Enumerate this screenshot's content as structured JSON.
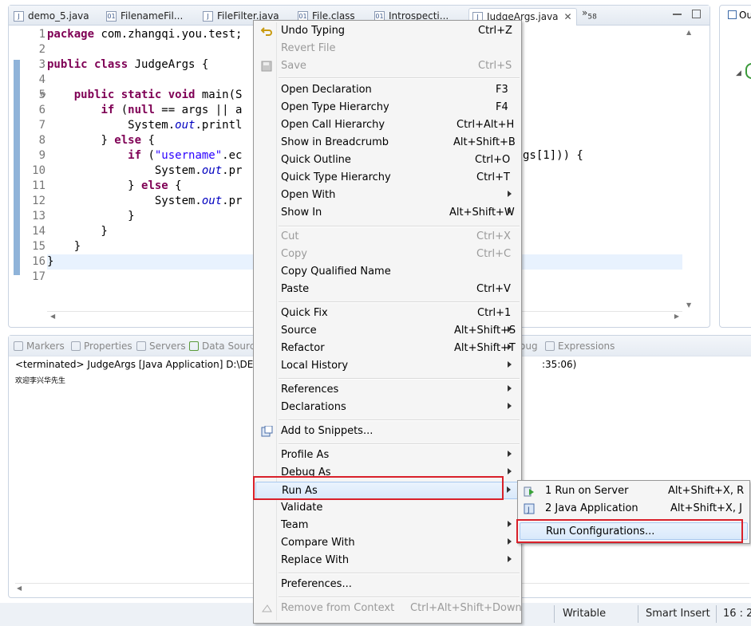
{
  "editor": {
    "tabs": [
      {
        "label": "demo_5.java",
        "icon": "java-file-icon"
      },
      {
        "label": "FilenameFil...",
        "icon": "class-file-icon"
      },
      {
        "label": "FileFilter.java",
        "icon": "java-file-icon"
      },
      {
        "label": "File.class",
        "icon": "class-file-icon"
      },
      {
        "label": "Introspecti...",
        "icon": "class-file-icon"
      },
      {
        "label": "JudgeArgs.java",
        "icon": "java-file-icon",
        "active": true
      }
    ],
    "overflow_label": "»",
    "overflow_count": "58",
    "close_glyph": "✕",
    "line_numbers": [
      "1",
      "2",
      "3",
      "4",
      "5",
      "6",
      "7",
      "8",
      "9",
      "10",
      "11",
      "12",
      "13",
      "14",
      "15",
      "16",
      "17"
    ],
    "code": {
      "l1_kw": "package",
      "l1_rest": " com.zhangqi.you.test;",
      "l3_kw": "public class",
      "l3_rest": " JudgeArgs {",
      "l5_indent": "    ",
      "l5_kw": "public static void",
      "l5_rest": " main(S",
      "l6_indent": "        ",
      "l6_kw1": "if",
      "l6_mid1": " (",
      "l6_kw2": "null",
      "l6_rest": " == args || a",
      "l7_indent": "            ",
      "l7_a": "System.",
      "l7_b": "out",
      "l7_c": ".printl",
      "l8_indent": "        ",
      "l8_a": "} ",
      "l8_kw": "else",
      "l8_b": " {",
      "l9_indent": "            ",
      "l9_kw": "if",
      "l9_a": " (",
      "l9_str": "\"username\"",
      "l9_b": ".ec",
      "l9_tail": "gs[1])) {",
      "l10_indent": "                ",
      "l10_a": "System.",
      "l10_b": "out",
      "l10_c": ".pr",
      "l11_indent": "            ",
      "l11_a": "} ",
      "l11_kw": "else",
      "l11_b": " {",
      "l12_indent": "                ",
      "l12_a": "System.",
      "l12_b": "out",
      "l12_c": ".pr",
      "l13": "            }",
      "l14": "        }",
      "l15": "    }",
      "l16": "}"
    }
  },
  "outline": {
    "title": "Ou"
  },
  "console": {
    "tabs": [
      {
        "label": "Markers"
      },
      {
        "label": "Properties"
      },
      {
        "label": "Servers"
      },
      {
        "label": "Data Source"
      },
      {
        "label": "oug"
      },
      {
        "label": "Expressions"
      }
    ],
    "header": "<terminated> JudgeArgs [Java Application] D:\\DEV_",
    "header_tail": ":35:06)",
    "output": "欢迎李兴华先生"
  },
  "statusbar": {
    "writable": "Writable",
    "insert_mode": "Smart Insert",
    "position": "16 : 2"
  },
  "context_menu": {
    "undo_typing": {
      "label": "Undo Typing",
      "accel": "Ctrl+Z"
    },
    "revert_file": {
      "label": "Revert File"
    },
    "save": {
      "label": "Save",
      "accel": "Ctrl+S"
    },
    "open_declaration": {
      "label": "Open Declaration",
      "accel": "F3"
    },
    "open_type_hierarchy": {
      "label": "Open Type Hierarchy",
      "accel": "F4"
    },
    "open_call_hierarchy": {
      "label": "Open Call Hierarchy",
      "accel": "Ctrl+Alt+H"
    },
    "show_in_breadcrumb": {
      "label": "Show in Breadcrumb",
      "accel": "Alt+Shift+B"
    },
    "quick_outline": {
      "label": "Quick Outline",
      "accel": "Ctrl+O"
    },
    "quick_type_hierarchy": {
      "label": "Quick Type Hierarchy",
      "accel": "Ctrl+T"
    },
    "open_with": {
      "label": "Open With"
    },
    "show_in": {
      "label": "Show In",
      "accel": "Alt+Shift+W"
    },
    "cut": {
      "label": "Cut",
      "accel": "Ctrl+X"
    },
    "copy": {
      "label": "Copy",
      "accel": "Ctrl+C"
    },
    "copy_qualified_name": {
      "label": "Copy Qualified Name"
    },
    "paste": {
      "label": "Paste",
      "accel": "Ctrl+V"
    },
    "quick_fix": {
      "label": "Quick Fix",
      "accel": "Ctrl+1"
    },
    "source": {
      "label": "Source",
      "accel": "Alt+Shift+S"
    },
    "refactor": {
      "label": "Refactor",
      "accel": "Alt+Shift+T"
    },
    "local_history": {
      "label": "Local History"
    },
    "references": {
      "label": "References"
    },
    "declarations": {
      "label": "Declarations"
    },
    "add_to_snippets": {
      "label": "Add to Snippets..."
    },
    "profile_as": {
      "label": "Profile As"
    },
    "debug_as": {
      "label": "Debug As"
    },
    "run_as": {
      "label": "Run As"
    },
    "validate": {
      "label": "Validate"
    },
    "team": {
      "label": "Team"
    },
    "compare_with": {
      "label": "Compare With"
    },
    "replace_with": {
      "label": "Replace With"
    },
    "preferences": {
      "label": "Preferences..."
    },
    "remove_from_context": {
      "label": "Remove from Context",
      "accel": "Ctrl+Alt+Shift+Down"
    }
  },
  "run_as_submenu": {
    "run_on_server": {
      "label": "1 Run on Server",
      "accel": "Alt+Shift+X, R"
    },
    "java_application": {
      "label": "2 Java Application",
      "accel": "Alt+Shift+X, J"
    },
    "run_configurations": {
      "label": "Run Configurations..."
    }
  },
  "colors": {
    "keyword": "#7f0055",
    "string": "#2a00ff",
    "field": "#0000c0",
    "highlight_box": "#d9202a",
    "menu_selection": "#d9e9fb"
  }
}
